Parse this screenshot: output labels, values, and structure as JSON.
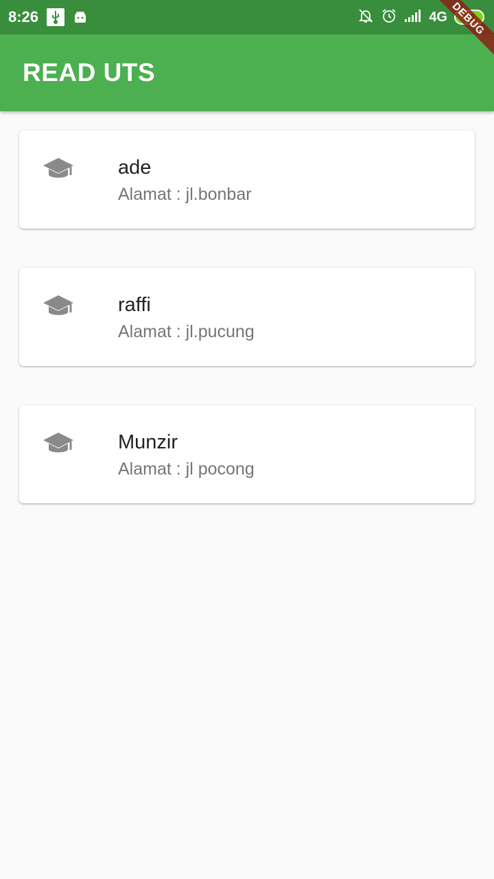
{
  "status_bar": {
    "time": "8:26",
    "left_icons": [
      "usb-icon",
      "android-icon"
    ],
    "right_icons": [
      "notifications-off-icon",
      "alarm-icon",
      "signal-icon"
    ],
    "network": "4G",
    "battery": "90"
  },
  "app_bar": {
    "title": "READ UTS",
    "color": "#4caf50"
  },
  "debug_banner": "DEBUG",
  "items": [
    {
      "icon": "graduation-cap-icon",
      "name": "ade",
      "address": "Alamat : jl.bonbar"
    },
    {
      "icon": "graduation-cap-icon",
      "name": "raffi",
      "address": "Alamat : jl.pucung"
    },
    {
      "icon": "graduation-cap-icon",
      "name": "Munzir",
      "address": "Alamat : jl pocong"
    }
  ]
}
